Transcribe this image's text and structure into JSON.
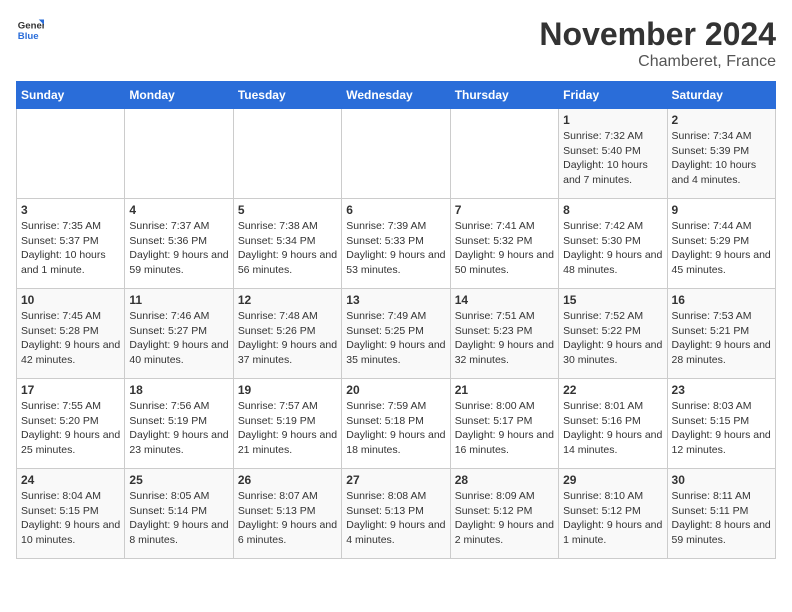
{
  "logo": {
    "text_general": "General",
    "text_blue": "Blue"
  },
  "header": {
    "title": "November 2024",
    "subtitle": "Chamberet, France"
  },
  "weekdays": [
    "Sunday",
    "Monday",
    "Tuesday",
    "Wednesday",
    "Thursday",
    "Friday",
    "Saturday"
  ],
  "weeks": [
    [
      {
        "day": "",
        "detail": ""
      },
      {
        "day": "",
        "detail": ""
      },
      {
        "day": "",
        "detail": ""
      },
      {
        "day": "",
        "detail": ""
      },
      {
        "day": "",
        "detail": ""
      },
      {
        "day": "1",
        "detail": "Sunrise: 7:32 AM\nSunset: 5:40 PM\nDaylight: 10 hours and 7 minutes."
      },
      {
        "day": "2",
        "detail": "Sunrise: 7:34 AM\nSunset: 5:39 PM\nDaylight: 10 hours and 4 minutes."
      }
    ],
    [
      {
        "day": "3",
        "detail": "Sunrise: 7:35 AM\nSunset: 5:37 PM\nDaylight: 10 hours and 1 minute."
      },
      {
        "day": "4",
        "detail": "Sunrise: 7:37 AM\nSunset: 5:36 PM\nDaylight: 9 hours and 59 minutes."
      },
      {
        "day": "5",
        "detail": "Sunrise: 7:38 AM\nSunset: 5:34 PM\nDaylight: 9 hours and 56 minutes."
      },
      {
        "day": "6",
        "detail": "Sunrise: 7:39 AM\nSunset: 5:33 PM\nDaylight: 9 hours and 53 minutes."
      },
      {
        "day": "7",
        "detail": "Sunrise: 7:41 AM\nSunset: 5:32 PM\nDaylight: 9 hours and 50 minutes."
      },
      {
        "day": "8",
        "detail": "Sunrise: 7:42 AM\nSunset: 5:30 PM\nDaylight: 9 hours and 48 minutes."
      },
      {
        "day": "9",
        "detail": "Sunrise: 7:44 AM\nSunset: 5:29 PM\nDaylight: 9 hours and 45 minutes."
      }
    ],
    [
      {
        "day": "10",
        "detail": "Sunrise: 7:45 AM\nSunset: 5:28 PM\nDaylight: 9 hours and 42 minutes."
      },
      {
        "day": "11",
        "detail": "Sunrise: 7:46 AM\nSunset: 5:27 PM\nDaylight: 9 hours and 40 minutes."
      },
      {
        "day": "12",
        "detail": "Sunrise: 7:48 AM\nSunset: 5:26 PM\nDaylight: 9 hours and 37 minutes."
      },
      {
        "day": "13",
        "detail": "Sunrise: 7:49 AM\nSunset: 5:25 PM\nDaylight: 9 hours and 35 minutes."
      },
      {
        "day": "14",
        "detail": "Sunrise: 7:51 AM\nSunset: 5:23 PM\nDaylight: 9 hours and 32 minutes."
      },
      {
        "day": "15",
        "detail": "Sunrise: 7:52 AM\nSunset: 5:22 PM\nDaylight: 9 hours and 30 minutes."
      },
      {
        "day": "16",
        "detail": "Sunrise: 7:53 AM\nSunset: 5:21 PM\nDaylight: 9 hours and 28 minutes."
      }
    ],
    [
      {
        "day": "17",
        "detail": "Sunrise: 7:55 AM\nSunset: 5:20 PM\nDaylight: 9 hours and 25 minutes."
      },
      {
        "day": "18",
        "detail": "Sunrise: 7:56 AM\nSunset: 5:19 PM\nDaylight: 9 hours and 23 minutes."
      },
      {
        "day": "19",
        "detail": "Sunrise: 7:57 AM\nSunset: 5:19 PM\nDaylight: 9 hours and 21 minutes."
      },
      {
        "day": "20",
        "detail": "Sunrise: 7:59 AM\nSunset: 5:18 PM\nDaylight: 9 hours and 18 minutes."
      },
      {
        "day": "21",
        "detail": "Sunrise: 8:00 AM\nSunset: 5:17 PM\nDaylight: 9 hours and 16 minutes."
      },
      {
        "day": "22",
        "detail": "Sunrise: 8:01 AM\nSunset: 5:16 PM\nDaylight: 9 hours and 14 minutes."
      },
      {
        "day": "23",
        "detail": "Sunrise: 8:03 AM\nSunset: 5:15 PM\nDaylight: 9 hours and 12 minutes."
      }
    ],
    [
      {
        "day": "24",
        "detail": "Sunrise: 8:04 AM\nSunset: 5:15 PM\nDaylight: 9 hours and 10 minutes."
      },
      {
        "day": "25",
        "detail": "Sunrise: 8:05 AM\nSunset: 5:14 PM\nDaylight: 9 hours and 8 minutes."
      },
      {
        "day": "26",
        "detail": "Sunrise: 8:07 AM\nSunset: 5:13 PM\nDaylight: 9 hours and 6 minutes."
      },
      {
        "day": "27",
        "detail": "Sunrise: 8:08 AM\nSunset: 5:13 PM\nDaylight: 9 hours and 4 minutes."
      },
      {
        "day": "28",
        "detail": "Sunrise: 8:09 AM\nSunset: 5:12 PM\nDaylight: 9 hours and 2 minutes."
      },
      {
        "day": "29",
        "detail": "Sunrise: 8:10 AM\nSunset: 5:12 PM\nDaylight: 9 hours and 1 minute."
      },
      {
        "day": "30",
        "detail": "Sunrise: 8:11 AM\nSunset: 5:11 PM\nDaylight: 8 hours and 59 minutes."
      }
    ]
  ]
}
